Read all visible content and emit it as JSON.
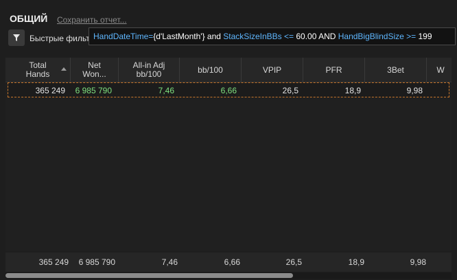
{
  "header": {
    "title": "ОБЩИЙ",
    "save_link": "Сохранить отчет..."
  },
  "filter": {
    "quick_label": "Быстрые фильт",
    "icon": "filter-icon",
    "expression": [
      {
        "text": "HandDateTime",
        "kind": "field"
      },
      {
        "text": "=",
        "kind": "op"
      },
      {
        "text": "{d'LastMonth'}",
        "kind": "val"
      },
      {
        "text": " and ",
        "kind": "val"
      },
      {
        "text": "StackSizeInBBs",
        "kind": "field"
      },
      {
        "text": " <= ",
        "kind": "op"
      },
      {
        "text": "60.00",
        "kind": "val"
      },
      {
        "text": " AND ",
        "kind": "val"
      },
      {
        "text": "HandBigBlindSize",
        "kind": "field"
      },
      {
        "text": " >= ",
        "kind": "op"
      },
      {
        "text": "199",
        "kind": "val"
      }
    ]
  },
  "grid": {
    "columns": [
      {
        "label": "Total\nHands",
        "sorted": "asc"
      },
      {
        "label": "Net\nWon..."
      },
      {
        "label": "All-in Adj\nbb/100"
      },
      {
        "label": "bb/100"
      },
      {
        "label": "VPIP"
      },
      {
        "label": "PFR"
      },
      {
        "label": "3Bet"
      },
      {
        "label": "W"
      }
    ],
    "rows": [
      [
        "365 249",
        "6 985 790",
        "7,46",
        "6,66",
        "26,5",
        "18,9",
        "9,98"
      ]
    ],
    "row_colors": [
      "white",
      "green",
      "green",
      "green",
      "white",
      "white",
      "white"
    ],
    "totals": [
      "365 249",
      "6 985 790",
      "7,46",
      "6,66",
      "26,5",
      "18,9",
      "9,98"
    ]
  },
  "colors": {
    "field": "#5fb7ff",
    "positive": "#7ee07e",
    "selection": "#c8762a"
  }
}
